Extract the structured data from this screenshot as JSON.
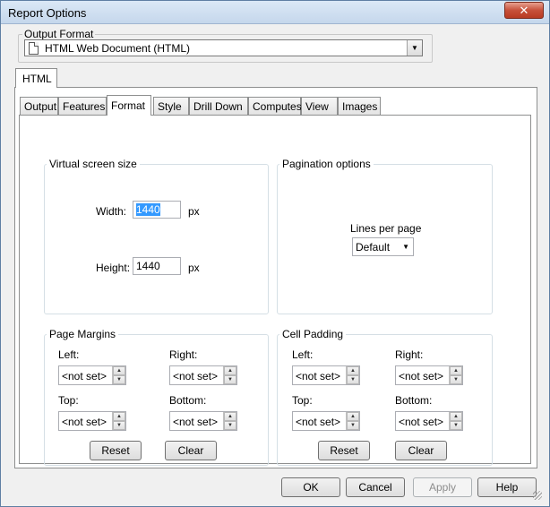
{
  "window": {
    "title": "Report Options",
    "close_label": "✕"
  },
  "output_format": {
    "label": "Output Format",
    "value": "HTML Web Document (HTML)"
  },
  "outer_tab": {
    "label": "HTML"
  },
  "inner_tabs": [
    {
      "label": "Output"
    },
    {
      "label": "Features"
    },
    {
      "label": "Format"
    },
    {
      "label": "Style"
    },
    {
      "label": "Drill Down"
    },
    {
      "label": "Computes"
    },
    {
      "label": "View"
    },
    {
      "label": "Images"
    }
  ],
  "active_tab": "Format",
  "virtual_screen": {
    "label": "Virtual screen size",
    "width_label": "Width:",
    "width_value": "1440",
    "height_label": "Height:",
    "height_value": "1440",
    "unit": "px"
  },
  "pagination": {
    "label": "Pagination options",
    "lines_label": "Lines per page",
    "lines_value": "Default"
  },
  "page_margins": {
    "label": "Page Margins",
    "left_label": "Left:",
    "right_label": "Right:",
    "top_label": "Top:",
    "bottom_label": "Bottom:",
    "left_value": "<not set>",
    "right_value": "<not set>",
    "top_value": "<not set>",
    "bottom_value": "<not set>",
    "reset_label": "Reset",
    "clear_label": "Clear"
  },
  "cell_padding": {
    "label": "Cell Padding",
    "left_label": "Left:",
    "right_label": "Right:",
    "top_label": "Top:",
    "bottom_label": "Bottom:",
    "left_value": "<not set>",
    "right_value": "<not set>",
    "top_value": "<not set>",
    "bottom_value": "<not set>",
    "reset_label": "Reset",
    "clear_label": "Clear"
  },
  "footer": {
    "ok_label": "OK",
    "cancel_label": "Cancel",
    "apply_label": "Apply",
    "help_label": "Help"
  }
}
